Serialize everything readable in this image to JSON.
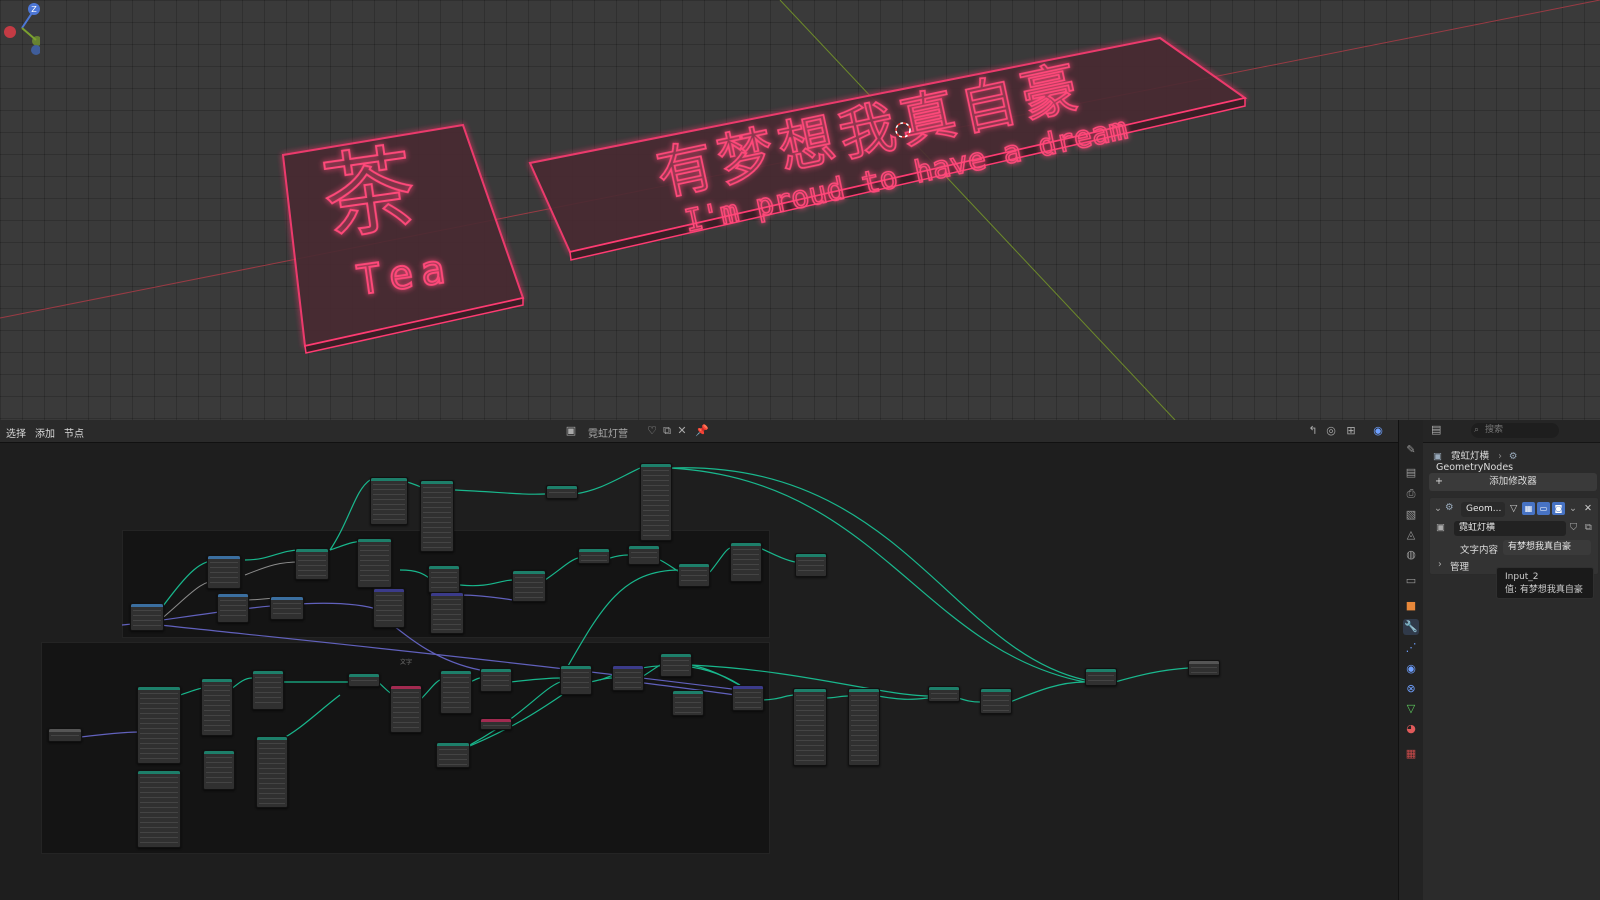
{
  "viewport": {
    "sign_left": {
      "chinese": "茶",
      "english": "Tea"
    },
    "sign_right": {
      "chinese": "有梦想我真自豪",
      "english": "I'm proud to have a dream"
    },
    "neon_color": "#ff2d6b"
  },
  "node_editor": {
    "menu": [
      "选择",
      "添加",
      "节点"
    ],
    "node_tree_name": "霓虹灯营",
    "frame_label": "文字"
  },
  "properties": {
    "search_placeholder": "搜索",
    "breadcrumb": {
      "object": "霓虹灯横",
      "modifier": "GeometryNodes"
    },
    "add_modifier": "添加修改器",
    "modifier": {
      "name": "Geom...",
      "node_group": "霓虹灯横",
      "input_label": "文字内容",
      "input_value": "有梦想我真自豪",
      "manage_label": "管理"
    },
    "tooltip": {
      "title": "Input_2",
      "value": "值: 有梦想我真自豪"
    }
  },
  "colors": {
    "accent": "#4773c4",
    "geometry_wire": "#00d6a3",
    "string_wire": "#6363c7"
  }
}
